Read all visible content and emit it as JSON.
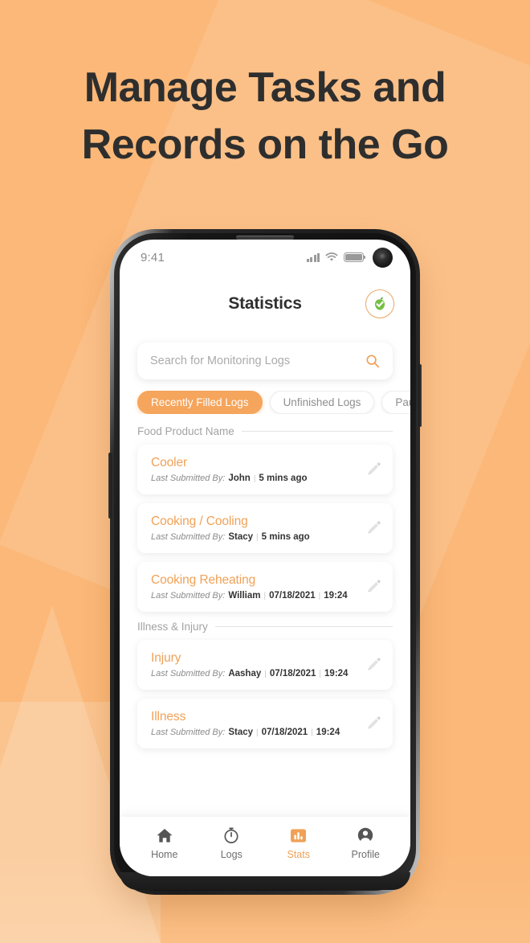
{
  "hero": {
    "headline_line1": "Manage Tasks and",
    "headline_line2": "Records on the Go"
  },
  "theme": {
    "background": "#FBB878",
    "accent_orange": "#F0A157",
    "chip_active": "#F5A55C",
    "headline_color": "#2E2E2E",
    "badge_green": "#6FBE44"
  },
  "phone": {
    "status_bar": {
      "time": "9:41",
      "signal_icon": "signal-bars-icon",
      "wifi_icon": "wifi-icon",
      "battery_icon": "battery-full-icon",
      "camera_icon": "front-camera-icon"
    },
    "header": {
      "title": "Statistics",
      "badge_icon": "green-apple-check-icon"
    },
    "search": {
      "value": "",
      "placeholder": "Search for Monitoring Logs",
      "icon": "search-icon"
    },
    "filters": [
      {
        "label": "Recently Filled Logs",
        "active": true
      },
      {
        "label": "Unfinished Logs",
        "active": false
      },
      {
        "label": "Paused",
        "active": false
      }
    ],
    "sections": [
      {
        "label": "Food Product Name",
        "items": [
          {
            "title": "Cooler",
            "meta_label": "Last Submitted By:",
            "submitter": "John",
            "detail_1": "5 mins ago",
            "detail_2": "",
            "edit_icon": "pencil-icon"
          },
          {
            "title": "Cooking / Cooling",
            "meta_label": "Last Submitted By:",
            "submitter": "Stacy",
            "detail_1": "5 mins ago",
            "detail_2": "",
            "edit_icon": "pencil-icon"
          },
          {
            "title": "Cooking Reheating",
            "meta_label": "Last Submitted By:",
            "submitter": "William",
            "detail_1": "07/18/2021",
            "detail_2": "19:24",
            "edit_icon": "pencil-icon"
          }
        ]
      },
      {
        "label": "Illness & Injury",
        "items": [
          {
            "title": "Injury",
            "meta_label": "Last Submitted By:",
            "submitter": "Aashay",
            "detail_1": "07/18/2021",
            "detail_2": "19:24",
            "edit_icon": "pencil-icon"
          },
          {
            "title": "Illness",
            "meta_label": "Last Submitted By:",
            "submitter": "Stacy",
            "detail_1": "07/18/2021",
            "detail_2": "19:24",
            "edit_icon": "pencil-icon"
          }
        ]
      }
    ],
    "bottom_nav": [
      {
        "label": "Home",
        "icon": "home-icon",
        "active": false
      },
      {
        "label": "Logs",
        "icon": "stopwatch-icon",
        "active": false
      },
      {
        "label": "Stats",
        "icon": "bar-chart-icon",
        "active": true
      },
      {
        "label": "Profile",
        "icon": "person-icon",
        "active": false
      }
    ],
    "separator": "|"
  }
}
